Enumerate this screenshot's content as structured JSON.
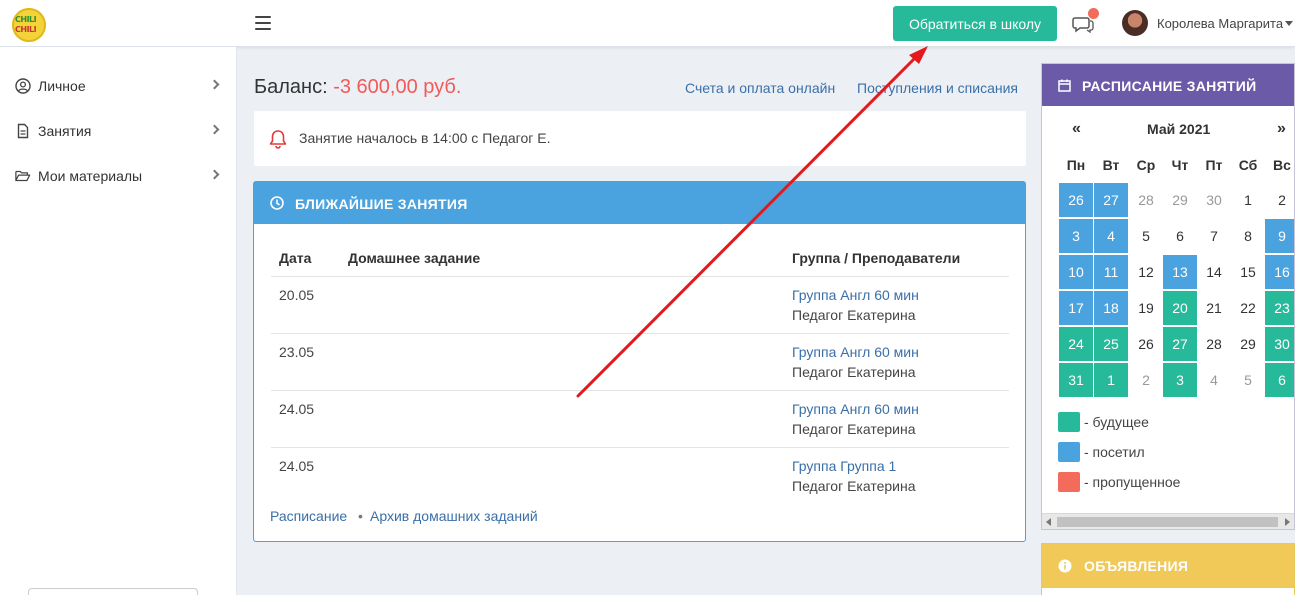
{
  "header": {
    "logo_line1": "CHILI",
    "logo_line2": "CHILI",
    "contact_button": "Обратиться в школу",
    "user_name": "Королева Маргарита"
  },
  "sidebar": {
    "items": [
      {
        "label": "Личное",
        "icon": "user-circle-icon"
      },
      {
        "label": "Занятия",
        "icon": "document-icon"
      },
      {
        "label": "Мои материалы",
        "icon": "folder-open-icon"
      }
    ]
  },
  "balance": {
    "label": "Баланс:",
    "amount": "-3 600,00 руб.",
    "links": [
      "Счета и оплата онлайн",
      "Поступления и списания"
    ]
  },
  "notice": {
    "text": "Занятие началось в 14:00 с Педагог Е."
  },
  "upcoming": {
    "title": "БЛИЖАЙШИЕ ЗАНЯТИЯ",
    "columns": [
      "Дата",
      "Домашнее задание",
      "Группа / Преподаватели"
    ],
    "rows": [
      {
        "date": "20.05",
        "homework": "",
        "group": "Группа Англ 60 мин",
        "teacher": "Педагог Екатерина"
      },
      {
        "date": "23.05",
        "homework": "",
        "group": "Группа Англ 60 мин",
        "teacher": "Педагог Екатерина"
      },
      {
        "date": "24.05",
        "homework": "",
        "group": "Группа Англ 60 мин",
        "teacher": "Педагог Екатерина"
      },
      {
        "date": "24.05",
        "homework": "",
        "group": "Группа Группа 1",
        "teacher": "Педагог Екатерина"
      }
    ],
    "footer_links": [
      "Расписание",
      "Архив домашних заданий"
    ],
    "footer_separator": "•"
  },
  "calendar": {
    "title": "РАСПИСАНИЕ ЗАНЯТИЙ",
    "prev": "«",
    "next": "»",
    "month": "Май 2021",
    "weekdays": [
      "Пн",
      "Вт",
      "Ср",
      "Чт",
      "Пт",
      "Сб",
      "Вс"
    ],
    "weeks": [
      [
        {
          "d": "26",
          "s": "visited",
          "m": true,
          "o": true
        },
        {
          "d": "27",
          "s": "visited",
          "m": true,
          "o": true
        },
        {
          "d": "28",
          "s": "",
          "m": false,
          "o": true
        },
        {
          "d": "29",
          "s": "",
          "m": false,
          "o": true
        },
        {
          "d": "30",
          "s": "",
          "m": false,
          "o": true
        },
        {
          "d": "1",
          "s": "",
          "m": false,
          "o": false
        },
        {
          "d": "2",
          "s": "",
          "m": false,
          "o": false
        }
      ],
      [
        {
          "d": "3",
          "s": "visited",
          "m": true,
          "o": false
        },
        {
          "d": "4",
          "s": "visited",
          "m": true,
          "o": false
        },
        {
          "d": "5",
          "s": "",
          "m": false,
          "o": false
        },
        {
          "d": "6",
          "s": "",
          "m": false,
          "o": false
        },
        {
          "d": "7",
          "s": "",
          "m": false,
          "o": false
        },
        {
          "d": "8",
          "s": "",
          "m": false,
          "o": false
        },
        {
          "d": "9",
          "s": "visited",
          "m": false,
          "o": false
        }
      ],
      [
        {
          "d": "10",
          "s": "visited",
          "m": true,
          "o": false
        },
        {
          "d": "11",
          "s": "visited",
          "m": true,
          "o": false
        },
        {
          "d": "12",
          "s": "",
          "m": false,
          "o": false
        },
        {
          "d": "13",
          "s": "visited",
          "m": false,
          "o": false
        },
        {
          "d": "14",
          "s": "",
          "m": false,
          "o": false
        },
        {
          "d": "15",
          "s": "",
          "m": false,
          "o": false
        },
        {
          "d": "16",
          "s": "visited",
          "m": false,
          "o": false
        }
      ],
      [
        {
          "d": "17",
          "s": "visited",
          "m": true,
          "o": false
        },
        {
          "d": "18",
          "s": "visited",
          "m": true,
          "o": false
        },
        {
          "d": "19",
          "s": "",
          "m": false,
          "o": false
        },
        {
          "d": "20",
          "s": "future",
          "m": false,
          "o": false
        },
        {
          "d": "21",
          "s": "",
          "m": false,
          "o": false
        },
        {
          "d": "22",
          "s": "",
          "m": false,
          "o": false
        },
        {
          "d": "23",
          "s": "future",
          "m": false,
          "o": false
        }
      ],
      [
        {
          "d": "24",
          "s": "future",
          "m": true,
          "o": false
        },
        {
          "d": "25",
          "s": "future",
          "m": true,
          "o": false
        },
        {
          "d": "26",
          "s": "",
          "m": false,
          "o": false
        },
        {
          "d": "27",
          "s": "future",
          "m": false,
          "o": false
        },
        {
          "d": "28",
          "s": "",
          "m": false,
          "o": false
        },
        {
          "d": "29",
          "s": "",
          "m": false,
          "o": false
        },
        {
          "d": "30",
          "s": "future",
          "m": false,
          "o": false
        }
      ],
      [
        {
          "d": "31",
          "s": "future",
          "m": false,
          "o": false
        },
        {
          "d": "1",
          "s": "future",
          "m": false,
          "o": true
        },
        {
          "d": "2",
          "s": "",
          "m": false,
          "o": true
        },
        {
          "d": "3",
          "s": "future",
          "m": false,
          "o": true
        },
        {
          "d": "4",
          "s": "",
          "m": false,
          "o": true
        },
        {
          "d": "5",
          "s": "",
          "m": false,
          "o": true
        },
        {
          "d": "6",
          "s": "future",
          "m": false,
          "o": true
        }
      ]
    ],
    "legend": [
      {
        "label": "- будущее",
        "color": "#26b99a"
      },
      {
        "label": "- посетил",
        "color": "#4aa3df"
      },
      {
        "label": "- пропущенное",
        "color": "#f26b5b"
      }
    ]
  },
  "announcements": {
    "title": "ОБЪЯВЛЕНИЯ"
  },
  "colors": {
    "accent_green": "#26b99a",
    "accent_blue": "#4aa3df",
    "accent_purple": "#6a5aa8",
    "accent_yellow": "#f0c958",
    "negative_red": "#f05a5a",
    "annotation_red": "#e5191b"
  }
}
